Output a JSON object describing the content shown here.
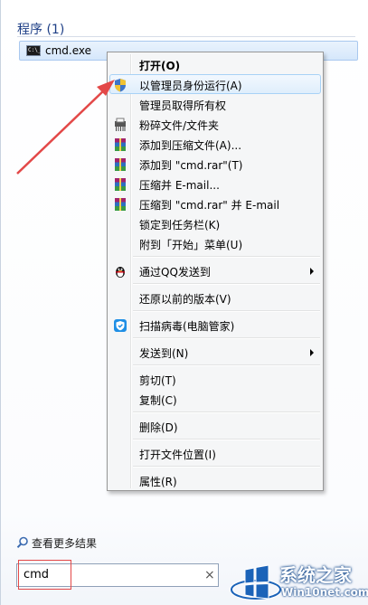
{
  "programs_section": {
    "header": "程序 (1)",
    "result": {
      "icon_text": "C:\\_",
      "label": "cmd.exe"
    }
  },
  "context_menu": {
    "items": [
      {
        "label": "打开(O)",
        "bold": true,
        "icon": ""
      },
      {
        "label": "以管理员身份运行(A)",
        "icon": "uac-shield-icon",
        "highlighted": true
      },
      {
        "label": "管理员取得所有权",
        "icon": ""
      },
      {
        "label": "粉碎文件/文件夹",
        "icon": "shredder-icon"
      },
      {
        "label": "添加到压缩文件(A)...",
        "icon": "winrar-icon"
      },
      {
        "label": "添加到 \"cmd.rar\"(T)",
        "icon": "winrar-icon"
      },
      {
        "label": "压缩并 E-mail...",
        "icon": "winrar-icon"
      },
      {
        "label": "压缩到 \"cmd.rar\" 并 E-mail",
        "icon": "winrar-icon"
      },
      {
        "label": "锁定到任务栏(K)",
        "icon": ""
      },
      {
        "label": "附到「开始」菜单(U)",
        "icon": ""
      },
      {
        "separator": true
      },
      {
        "label": "通过QQ发送到",
        "icon": "qq-penguin-icon",
        "submenu": true
      },
      {
        "separator": true
      },
      {
        "label": "还原以前的版本(V)",
        "icon": ""
      },
      {
        "separator": true
      },
      {
        "label": "扫描病毒(电脑管家)",
        "icon": "tencent-guard-icon"
      },
      {
        "separator": true
      },
      {
        "label": "发送到(N)",
        "icon": "",
        "submenu": true
      },
      {
        "separator": true
      },
      {
        "label": "剪切(T)",
        "icon": ""
      },
      {
        "label": "复制(C)",
        "icon": ""
      },
      {
        "separator": true
      },
      {
        "label": "删除(D)",
        "icon": ""
      },
      {
        "separator": true
      },
      {
        "label": "打开文件位置(I)",
        "icon": ""
      },
      {
        "separator": true
      },
      {
        "label": "属性(R)",
        "icon": ""
      }
    ]
  },
  "footer": {
    "more_results": "查看更多结果",
    "search_value": "cmd",
    "clear_glyph": "×"
  },
  "watermark": {
    "title": "系统之家",
    "url": "Win10net.com"
  },
  "colors": {
    "accent_blue": "#1e3f86",
    "highlight_border": "#a8d2f6",
    "annotation_red": "#e34848"
  }
}
